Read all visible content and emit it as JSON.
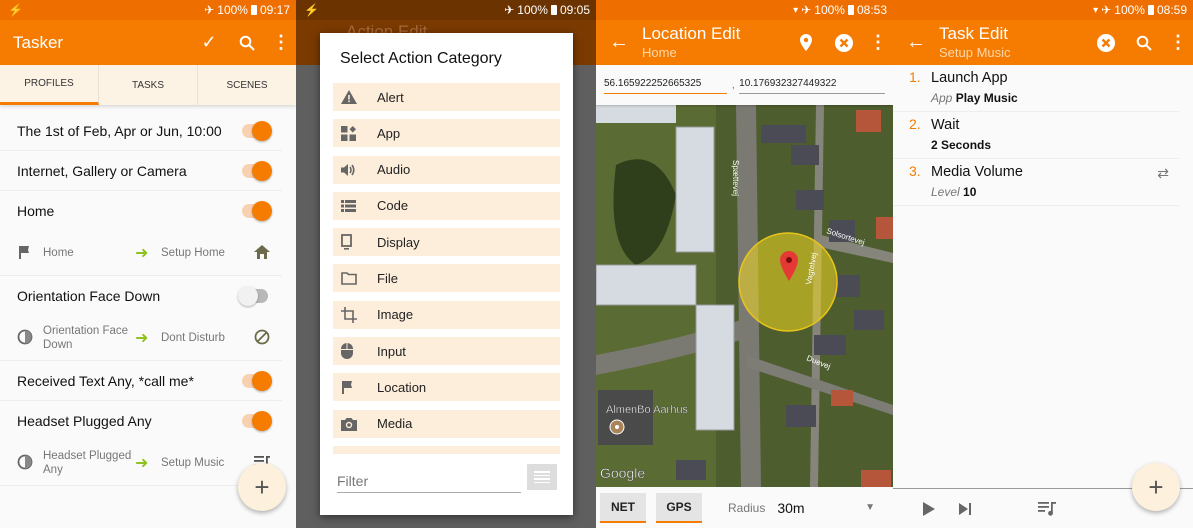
{
  "colors": {
    "accent": "#f57c00",
    "status_bar": "#ee6f00",
    "tab_bg": "#fdf3e5",
    "arrow_green": "#8dc21f"
  },
  "panel1": {
    "status": {
      "left_icon": "flash-icon",
      "battery": "100%",
      "time": "09:17"
    },
    "title": "Tasker",
    "actions": [
      "check-icon",
      "search-icon",
      "overflow-menu-icon"
    ],
    "tabs": [
      {
        "label": "PROFILES",
        "active": true
      },
      {
        "label": "TASKS",
        "active": false
      },
      {
        "label": "SCENES",
        "active": false
      }
    ],
    "profiles": [
      {
        "name": "The 1st of Feb, Apr or Jun, 10:00",
        "enabled": true
      },
      {
        "name": "Internet, Gallery or Camera",
        "enabled": true
      },
      {
        "name": "Home",
        "enabled": true,
        "context": "Home",
        "task": "Setup Home",
        "context_icon": "flag-icon",
        "task_icon": "home-icon"
      },
      {
        "name": "Orientation Face Down",
        "enabled": false,
        "context": "Orientation Face Down",
        "task": "Dont Disturb",
        "context_icon": "state-icon",
        "task_icon": "block-icon"
      },
      {
        "name": "Received Text Any, *call me*",
        "enabled": true
      },
      {
        "name": "Headset Plugged Any",
        "enabled": true,
        "context": "Headset Plugged Any",
        "task": "Setup Music",
        "context_icon": "state-icon",
        "task_icon": "playlist-icon"
      }
    ],
    "fab": "+"
  },
  "panel2": {
    "status": {
      "left_icon": "flash-icon",
      "battery": "100%",
      "time": "09:05"
    },
    "background_title": "Action Edit",
    "dialog_title": "Select Action Category",
    "categories": [
      {
        "label": "Alert",
        "icon": "alert-icon"
      },
      {
        "label": "App",
        "icon": "app-icon"
      },
      {
        "label": "Audio",
        "icon": "audio-icon"
      },
      {
        "label": "Code",
        "icon": "code-icon"
      },
      {
        "label": "Display",
        "icon": "display-icon"
      },
      {
        "label": "File",
        "icon": "folder-icon"
      },
      {
        "label": "Image",
        "icon": "crop-icon"
      },
      {
        "label": "Input",
        "icon": "mouse-icon"
      },
      {
        "label": "Location",
        "icon": "flag-icon"
      },
      {
        "label": "Media",
        "icon": "camera-icon"
      }
    ],
    "filter_placeholder": "Filter"
  },
  "panel3": {
    "status": {
      "battery": "100%",
      "time": "08:53"
    },
    "title": "Location Edit",
    "subtitle": "Home",
    "latitude": "56.165922252665325",
    "separator": ",",
    "longitude": "10.176932327449322",
    "map_labels": {
      "streets": [
        "Spættevej",
        "Solsortevej",
        "Vagtelvej",
        "Duevej"
      ],
      "place": "AlmenBo Aarhus",
      "attribution": "Google"
    },
    "buttons": {
      "net": "NET",
      "gps": "GPS"
    },
    "radius_label": "Radius",
    "radius_value": "30m"
  },
  "panel4": {
    "status": {
      "battery": "100%",
      "time": "08:59"
    },
    "title": "Task Edit",
    "subtitle": "Setup Music",
    "actions": [
      {
        "num": "1.",
        "name": "Launch App",
        "arg_label": "App",
        "arg_value": "Play Music"
      },
      {
        "num": "2.",
        "name": "Wait",
        "arg_label": "",
        "arg_value": "2 Seconds"
      },
      {
        "num": "3.",
        "name": "Media Volume",
        "arg_label": "Level",
        "arg_value": "10"
      }
    ],
    "fab": "+"
  }
}
